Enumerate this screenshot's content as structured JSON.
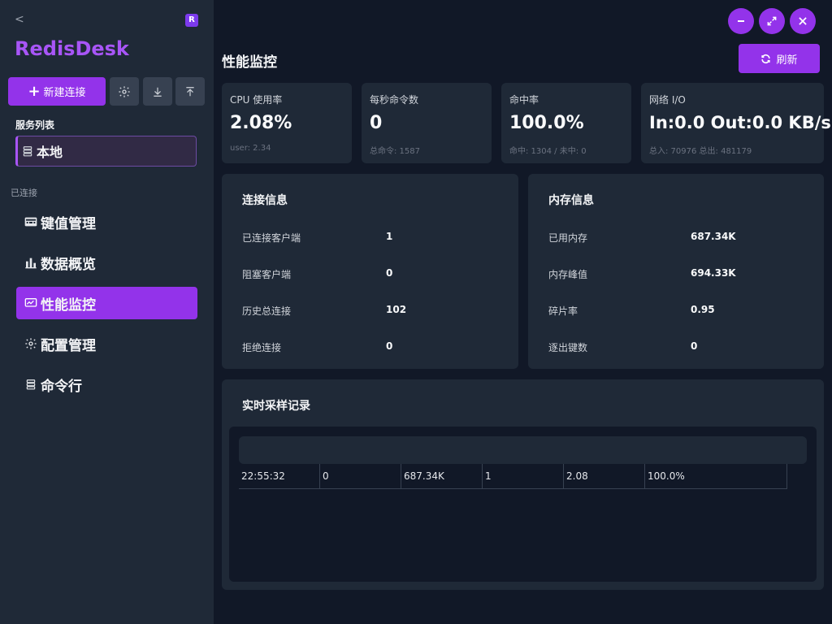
{
  "sidebar": {
    "collapse_label": "<",
    "badge_letter": "R",
    "app_title": "RedisDesk",
    "new_connection_label": "新建连接",
    "server_list_label": "服务列表",
    "server_name": "本地",
    "connected_label": "已连接",
    "nav": [
      {
        "label": "键值管理",
        "icon": "keyboard-icon"
      },
      {
        "label": "数据概览",
        "icon": "bar-chart-icon"
      },
      {
        "label": "性能监控",
        "icon": "monitor-chart-icon",
        "active": true
      },
      {
        "label": "配置管理",
        "icon": "gear-icon"
      },
      {
        "label": "命令行",
        "icon": "server-stack-icon"
      }
    ]
  },
  "header": {
    "title": "性能监控",
    "refresh_label": "刷新"
  },
  "stats": [
    {
      "label": "CPU 使用率",
      "value": "2.08%",
      "sub": "user: 2.34"
    },
    {
      "label": "每秒命令数",
      "value": "0",
      "sub": "总命令: 1587"
    },
    {
      "label": "命中率",
      "value": "100.0%",
      "sub": "命中: 1304 / 未中: 0"
    },
    {
      "label": "网络 I/O",
      "value": "In:0.0 Out:0.0 KB/s",
      "sub": "总入: 70976 总出: 481179"
    }
  ],
  "connection_info": {
    "title": "连接信息",
    "rows": [
      {
        "key": "已连接客户端",
        "value": "1"
      },
      {
        "key": "阻塞客户端",
        "value": "0"
      },
      {
        "key": "历史总连接",
        "value": "102"
      },
      {
        "key": "拒绝连接",
        "value": "0"
      }
    ]
  },
  "memory_info": {
    "title": "内存信息",
    "rows": [
      {
        "key": "已用内存",
        "value": "687.34K"
      },
      {
        "key": "内存峰值",
        "value": "694.33K"
      },
      {
        "key": "碎片率",
        "value": "0.95"
      },
      {
        "key": "逐出键数",
        "value": "0"
      }
    ]
  },
  "sampling": {
    "title": "实时采样记录",
    "rows": [
      [
        "22:55:32",
        "0",
        "687.34K",
        "1",
        "2.08",
        "100.0%"
      ]
    ]
  },
  "colors": {
    "accent": "#9333ea",
    "brand_text": "#a855f7",
    "sidebar_bg": "#1f2937",
    "main_bg": "#111827"
  }
}
